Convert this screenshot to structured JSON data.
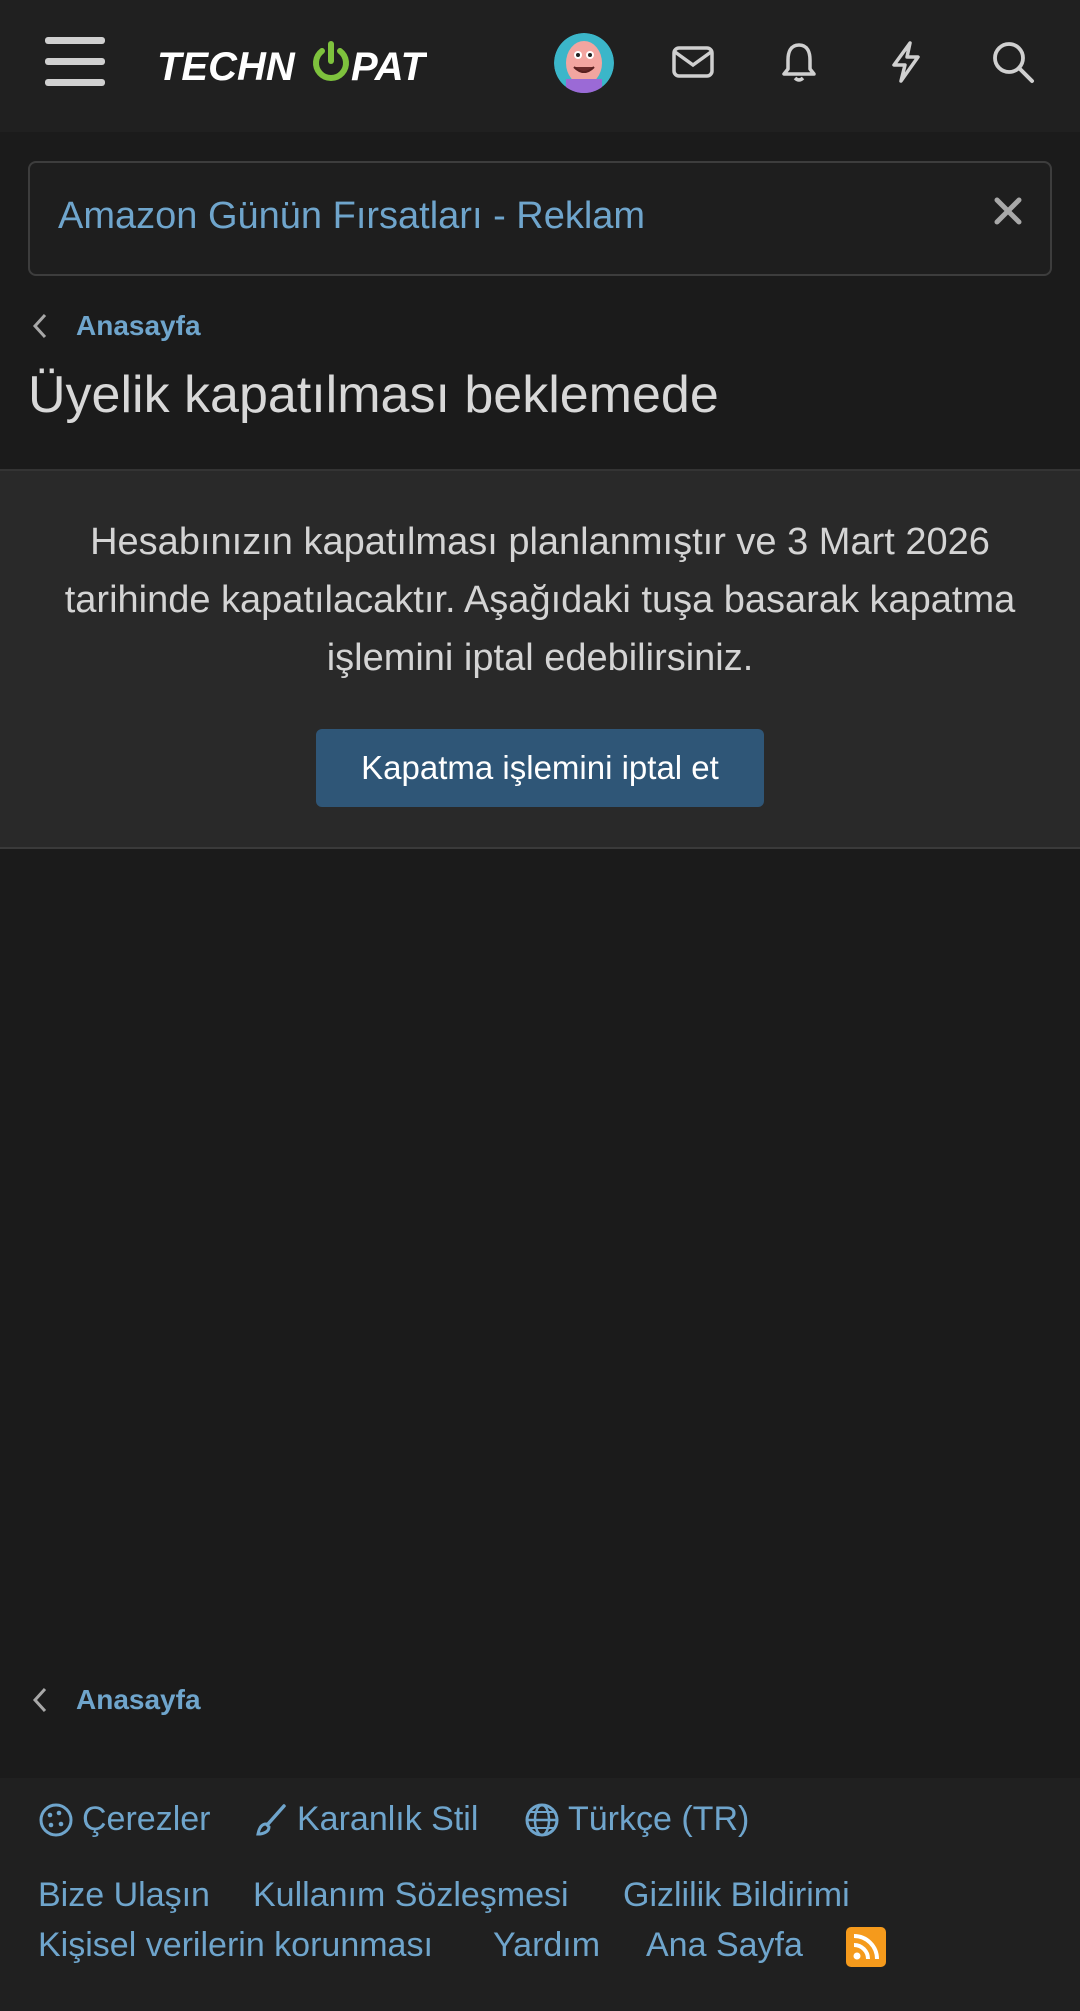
{
  "header": {
    "logo_text_1": "TECHN",
    "logo_text_2": "PAT",
    "icons": [
      "menu-icon",
      "avatar",
      "envelope-icon",
      "bell-icon",
      "bolt-icon",
      "search-icon"
    ]
  },
  "banner": {
    "link_text": "Amazon Günün Fırsatları - Reklam"
  },
  "breadcrumb": {
    "label": "Anasayfa"
  },
  "page": {
    "title": "Üyelik kapatılması beklemede"
  },
  "notice": {
    "message": "Hesabınızın kapatılması planlanmıştır ve 3 Mart 2026 tarihinde kapatılacaktır. Aşağıdaki tuşa basarak kapatma işlemini iptal edebilirsiniz.",
    "button_label": "Kapatma işlemini iptal et"
  },
  "footer": {
    "options": {
      "cookies": "Çerezler",
      "style": "Karanlık Stil",
      "language": "Türkçe (TR)"
    },
    "links": {
      "contact": "Bize Ulaşın",
      "terms": "Kullanım Sözleşmesi",
      "privacy": "Gizlilik Bildirimi",
      "personal_data": "Kişisel verilerin korunması",
      "help": "Yardım",
      "home": "Ana Sayfa"
    }
  },
  "colors": {
    "link": "#6fa5cc",
    "button": "#2f5677",
    "logo_accent": "#7ec23d",
    "rss": "#f59a1c"
  }
}
